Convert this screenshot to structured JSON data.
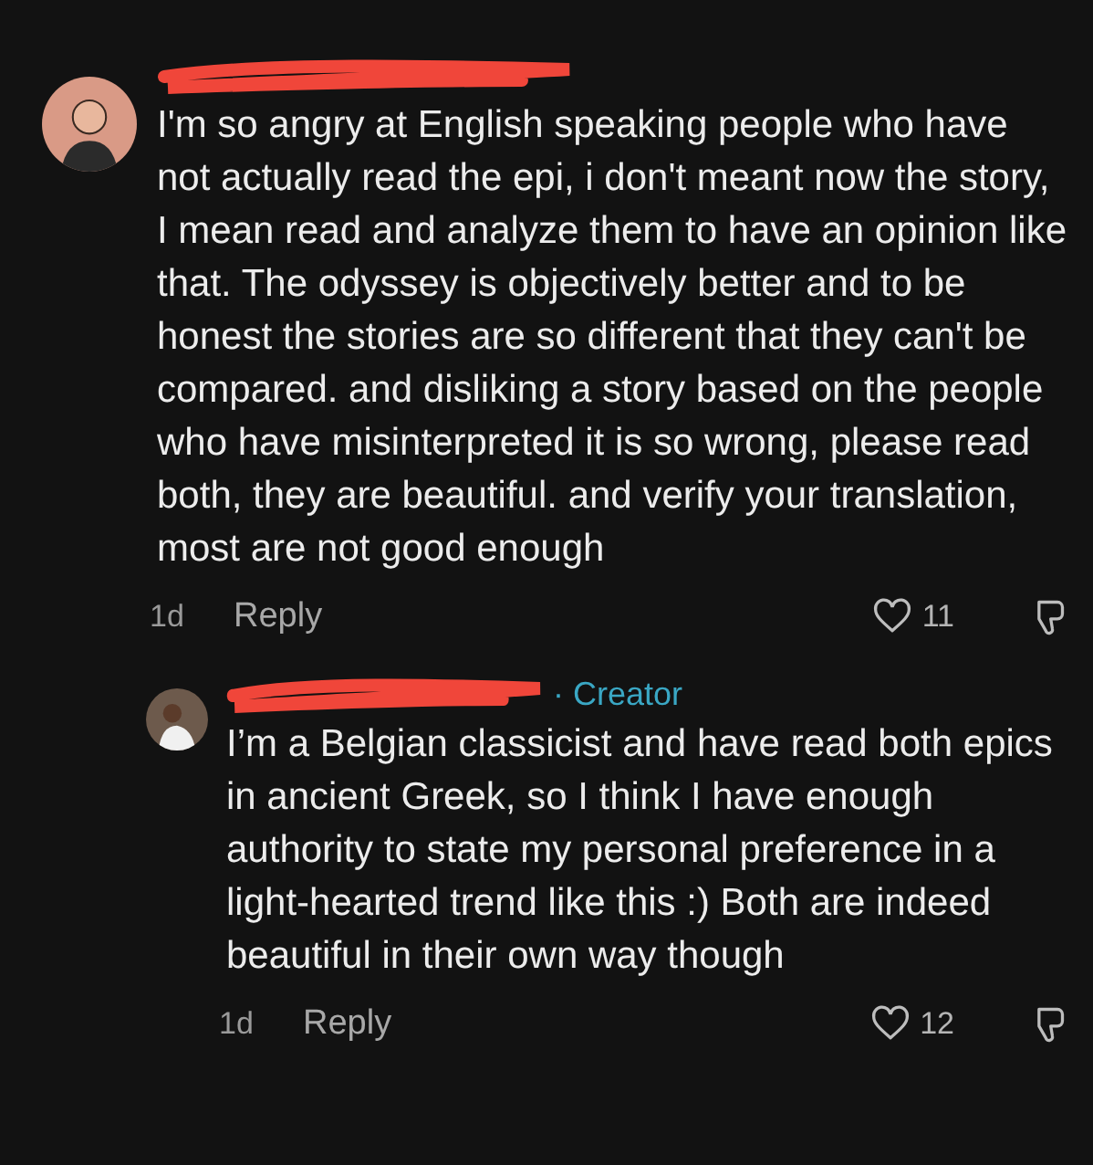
{
  "comments": [
    {
      "text": "I'm so angry at English speaking people who have not actually read the epi, i don't meant now the story, I mean read and analyze them to have an opinion like that. The odyssey is objectively better and to be honest the stories are so different that they can't be compared. and disliking a story based on the people who have misinterpreted it is so wrong, please read both, they are beautiful. and verify your translation, most are not good enough",
      "time": "1d",
      "reply": "Reply",
      "likes": "11",
      "liked": false,
      "replies": [
        {
          "text": "I’m a Belgian classicist and have read both epics in ancient Greek, so I think I have enough authority to state my personal preference in a light-hearted trend like this :) Both are indeed beautiful in their own way though",
          "time": "1d",
          "reply": "Reply",
          "likes": "12",
          "liked": false,
          "badge": "· Creator"
        }
      ]
    }
  ]
}
